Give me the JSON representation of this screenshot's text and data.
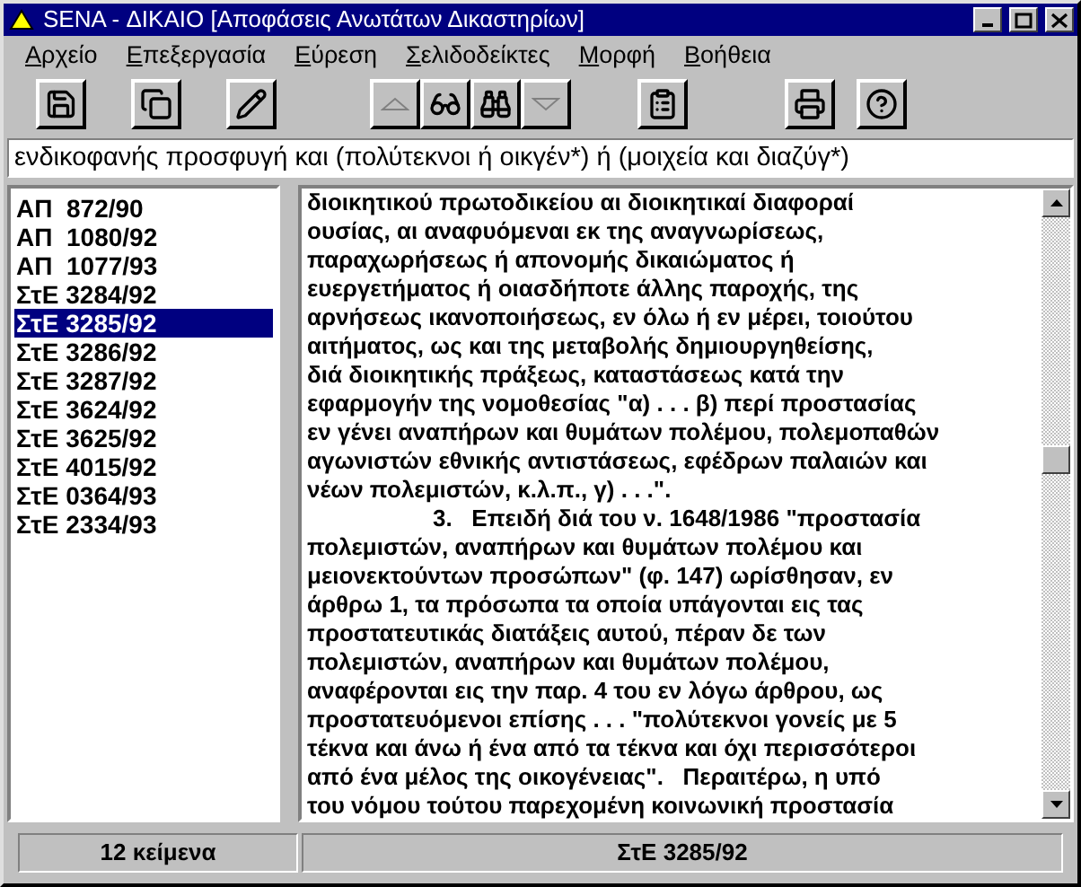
{
  "window": {
    "title": "SENA - ΔΙΚΑΙΟ [Αποφάσεις Ανωτάτων Δικαστηρίων]"
  },
  "menu": [
    "Αρχείο",
    "Επεξεργασία",
    "Εύρεση",
    "Σελιδοδείκτες",
    "Μορφή",
    "Βοήθεια"
  ],
  "toolbar": [
    [
      {
        "kind": "save"
      }
    ],
    [
      {
        "kind": "copy"
      }
    ],
    [
      {
        "kind": "edit"
      }
    ],
    [
      {
        "kind": "up"
      },
      {
        "kind": "glasses"
      },
      {
        "kind": "binoculars"
      },
      {
        "kind": "down"
      }
    ],
    [
      {
        "kind": "bookmark"
      }
    ],
    [
      {
        "kind": "print"
      }
    ],
    [
      {
        "kind": "help"
      }
    ]
  ],
  "query": {
    "value": "ενδικοφανής προσφυγή και (πολύτεκνοι ή οικγέν*) ή (μοιχεία και διαζύγ*)"
  },
  "documents": [
    {
      "label": "ΑΠ  872/90",
      "selected": false
    },
    {
      "label": "ΑΠ  1080/92",
      "selected": false
    },
    {
      "label": "ΑΠ  1077/93",
      "selected": false
    },
    {
      "label": "ΣτΕ 3284/92",
      "selected": false
    },
    {
      "label": "ΣτΕ 3285/92",
      "selected": true
    },
    {
      "label": "ΣτΕ 3286/92",
      "selected": false
    },
    {
      "label": "ΣτΕ 3287/92",
      "selected": false
    },
    {
      "label": "ΣτΕ 3624/92",
      "selected": false
    },
    {
      "label": "ΣτΕ 3625/92",
      "selected": false
    },
    {
      "label": "ΣτΕ 4015/92",
      "selected": false
    },
    {
      "label": "ΣτΕ 0364/93",
      "selected": false
    },
    {
      "label": "ΣτΕ 2334/93",
      "selected": false
    }
  ],
  "text_lines": [
    {
      "text": "διοικητικού πρωτοδικείου αι διοικητικαί διαφοραί",
      "indent": false
    },
    {
      "text": "ουσίας, αι αναφυόμεναι εκ της αναγνωρίσεως,",
      "indent": false
    },
    {
      "text": "παραχωρήσεως ή απονομής δικαιώματος ή",
      "indent": false
    },
    {
      "text": "ευεργετήματος ή οιασδήποτε άλλης παροχής, της",
      "indent": false
    },
    {
      "text": "αρνήσεως ικανοποιήσεως, εν όλω ή εν μέρει, τοιούτου",
      "indent": false
    },
    {
      "text": "αιτήματος, ως και της μεταβολής δημιουργηθείσης,",
      "indent": false
    },
    {
      "text": "διά διοικητικής πράξεως, καταστάσεως κατά την",
      "indent": false
    },
    {
      "text": "εφαρμογήν της νομοθεσίας \"α) . . . β) περί προστασίας",
      "indent": false
    },
    {
      "text": "εν γένει αναπήρων και θυμάτων πολέμου, πολεμοπαθών",
      "indent": false
    },
    {
      "text": "αγωνιστών εθνικής αντιστάσεως, εφέδρων παλαιών και",
      "indent": false
    },
    {
      "text": "νέων πολεμιστών, κ.λ.π., γ) . . .\".",
      "indent": false
    },
    {
      "text": "3.   Επειδή διά του ν. 1648/1986 \"προστασία",
      "indent": true
    },
    {
      "text": "πολεμιστών, αναπήρων και θυμάτων πολέμου και",
      "indent": false
    },
    {
      "text": "μειονεκτούντων προσώπων\" (φ. 147) ωρίσθησαν, εν",
      "indent": false
    },
    {
      "text": "άρθρω 1, τα πρόσωπα τα οποία υπάγονται εις τας",
      "indent": false
    },
    {
      "text": "προστατευτικάς διατάξεις αυτού, πέραν δε των",
      "indent": false
    },
    {
      "text": "πολεμιστών, αναπήρων και θυμάτων πολέμου,",
      "indent": false
    },
    {
      "text": "αναφέρονται εις την παρ. 4 του εν λόγω άρθρου, ως",
      "indent": false
    },
    {
      "text": "προστατευόμενοι επίσης . . . \"πολύτεκνοι γονείς με 5",
      "indent": false
    },
    {
      "text": "τέκνα και άνω ή ένα από τα τέκνα και όχι περισσότεροι",
      "indent": false
    },
    {
      "text": "από ένα μέλος της οικογένειας\".   Περαιτέρω, η υπό",
      "indent": false
    },
    {
      "text": "του νόμου τούτου παρεχομένη κοινωνική προστασία",
      "indent": false
    }
  ],
  "status_bar": {
    "count": "12 κείμενα",
    "current": "ΣτΕ 3285/92"
  }
}
